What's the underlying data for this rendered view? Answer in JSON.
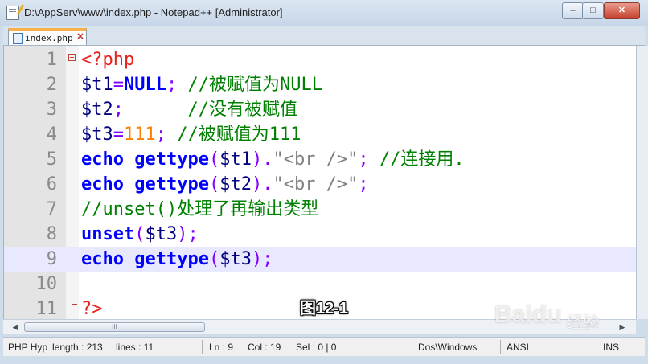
{
  "window": {
    "title": "D:\\AppServ\\www\\index.php - Notepad++ [Administrator]"
  },
  "controls": {
    "minimize": "–",
    "maximize": "□",
    "close": "✕"
  },
  "tab": {
    "label": "index.php"
  },
  "editor": {
    "current_line": 9,
    "lines": [
      {
        "num": "1",
        "tokens": [
          {
            "t": "<?php",
            "c": "tag"
          }
        ]
      },
      {
        "num": "2",
        "tokens": [
          {
            "t": "$t1",
            "c": "var"
          },
          {
            "t": "=",
            "c": "op"
          },
          {
            "t": "NULL",
            "c": "kw"
          },
          {
            "t": "; ",
            "c": "op"
          },
          {
            "t": "//被赋值为NULL",
            "c": "cm"
          }
        ]
      },
      {
        "num": "3",
        "tokens": [
          {
            "t": "$t2",
            "c": "var"
          },
          {
            "t": ";",
            "c": "op"
          },
          {
            "t": "      //没有被赋值",
            "c": "cm"
          }
        ]
      },
      {
        "num": "4",
        "tokens": [
          {
            "t": "$t3",
            "c": "var"
          },
          {
            "t": "=",
            "c": "op"
          },
          {
            "t": "111",
            "c": "num"
          },
          {
            "t": "; ",
            "c": "op"
          },
          {
            "t": "//被赋值为111",
            "c": "cm"
          }
        ]
      },
      {
        "num": "5",
        "tokens": [
          {
            "t": "echo",
            "c": "kw"
          },
          {
            "t": " ",
            "c": "op"
          },
          {
            "t": "gettype",
            "c": "kw"
          },
          {
            "t": "(",
            "c": "op"
          },
          {
            "t": "$t1",
            "c": "var"
          },
          {
            "t": ").",
            "c": "op"
          },
          {
            "t": "\"<br />\"",
            "c": "str"
          },
          {
            "t": "; ",
            "c": "op"
          },
          {
            "t": "//连接用.",
            "c": "cm"
          }
        ]
      },
      {
        "num": "6",
        "tokens": [
          {
            "t": "echo",
            "c": "kw"
          },
          {
            "t": " ",
            "c": "op"
          },
          {
            "t": "gettype",
            "c": "kw"
          },
          {
            "t": "(",
            "c": "op"
          },
          {
            "t": "$t2",
            "c": "var"
          },
          {
            "t": ").",
            "c": "op"
          },
          {
            "t": "\"<br />\"",
            "c": "str"
          },
          {
            "t": ";",
            "c": "op"
          }
        ]
      },
      {
        "num": "7",
        "tokens": [
          {
            "t": "//unset()处理了再输出类型",
            "c": "cm"
          }
        ]
      },
      {
        "num": "8",
        "tokens": [
          {
            "t": "unset",
            "c": "kw"
          },
          {
            "t": "(",
            "c": "op"
          },
          {
            "t": "$t3",
            "c": "var"
          },
          {
            "t": ");",
            "c": "op"
          }
        ]
      },
      {
        "num": "9",
        "tokens": [
          {
            "t": "echo",
            "c": "kw"
          },
          {
            "t": " ",
            "c": "op"
          },
          {
            "t": "gettype",
            "c": "kw"
          },
          {
            "t": "(",
            "c": "op"
          },
          {
            "t": "$t3",
            "c": "var"
          },
          {
            "t": ");",
            "c": "op"
          }
        ]
      },
      {
        "num": "10",
        "tokens": []
      },
      {
        "num": "11",
        "tokens": [
          {
            "t": "?>",
            "c": "tag"
          }
        ]
      }
    ]
  },
  "overlay": {
    "caption": "图12-1",
    "watermark": "Baidu",
    "watermark_sub": "经验"
  },
  "scrollbar": {
    "thumb_grip": "III",
    "left_arrow": "◀",
    "right_arrow": "▶"
  },
  "status": {
    "file_type": "PHP Hyp",
    "length": "length : 213",
    "lines": "lines : 11",
    "ln": "Ln : 9",
    "col": "Col : 19",
    "sel": "Sel : 0 | 0",
    "eol": "Dos\\Windows",
    "encoding": "ANSI",
    "mode": "INS"
  },
  "colors": {
    "tag": "#e8201a",
    "var": "#000080",
    "op": "#8000ff",
    "kw": "#0000ff",
    "cm": "#008000",
    "num": "#ff8000",
    "str": "#808080",
    "current_line": "#e8e8ff"
  }
}
